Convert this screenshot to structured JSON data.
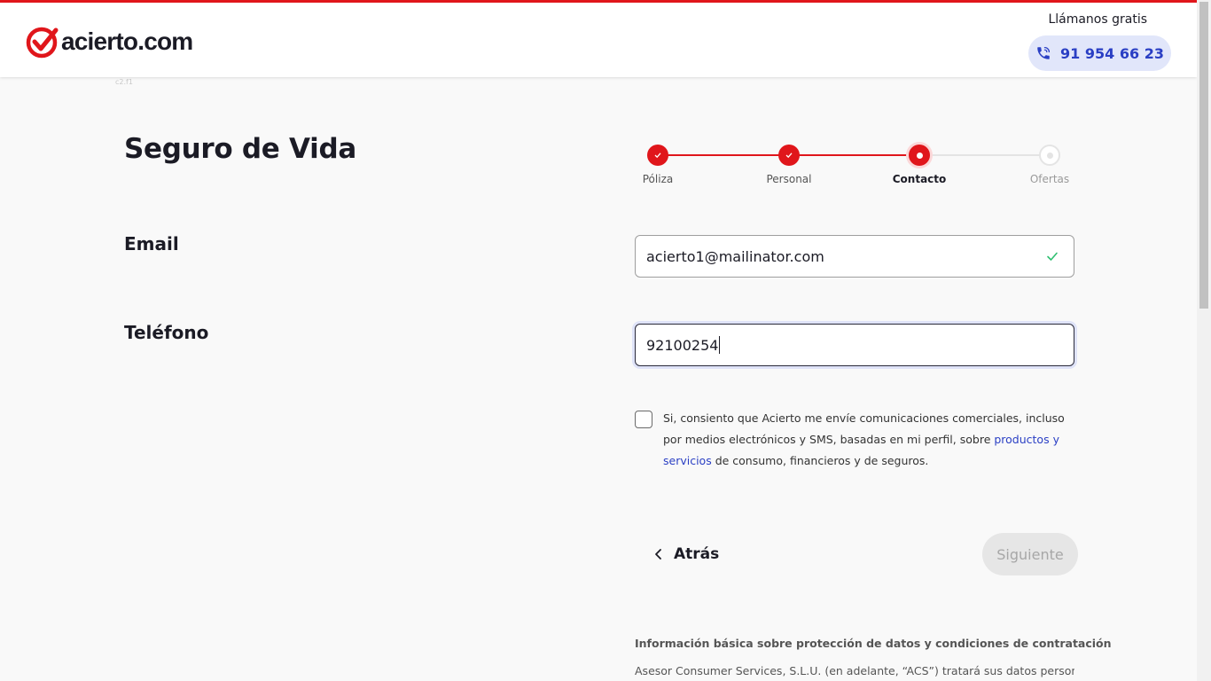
{
  "header": {
    "logo_text": "acierto.com",
    "call_label": "Llámanos gratis",
    "phone_number": "91 954 66 23",
    "tiny_tag": "c2.f1"
  },
  "page": {
    "title": "Seguro de Vida"
  },
  "stepper": {
    "steps": [
      {
        "label": "Póliza",
        "status": "done"
      },
      {
        "label": "Personal",
        "status": "done"
      },
      {
        "label": "Contacto",
        "status": "active"
      },
      {
        "label": "Ofertas",
        "status": "pending"
      }
    ]
  },
  "form": {
    "email": {
      "label": "Email",
      "value": "acierto1@mailinator.com",
      "valid": true
    },
    "phone": {
      "label": "Teléfono",
      "value": "92100254"
    },
    "consent": {
      "checked": false,
      "text_before": "Si, consiento que Acierto me envíe comunicaciones comerciales, incluso por medios electrónicos y SMS, basadas en mi perfil, sobre ",
      "link_text": "productos y servicios",
      "text_after": " de consumo, financieros y de seguros."
    }
  },
  "navigation": {
    "back_label": "Atrás",
    "next_label": "Siguiente"
  },
  "info": {
    "title": "Información básica sobre protección de datos y condiciones de contratación",
    "text": "Asesor Consumer Services, S.L.U. (en adelante, “ACS”) tratará sus datos personales"
  },
  "colors": {
    "brand_red": "#e0161b",
    "link_blue": "#2a3fc4",
    "success_green": "#2fbf71"
  }
}
